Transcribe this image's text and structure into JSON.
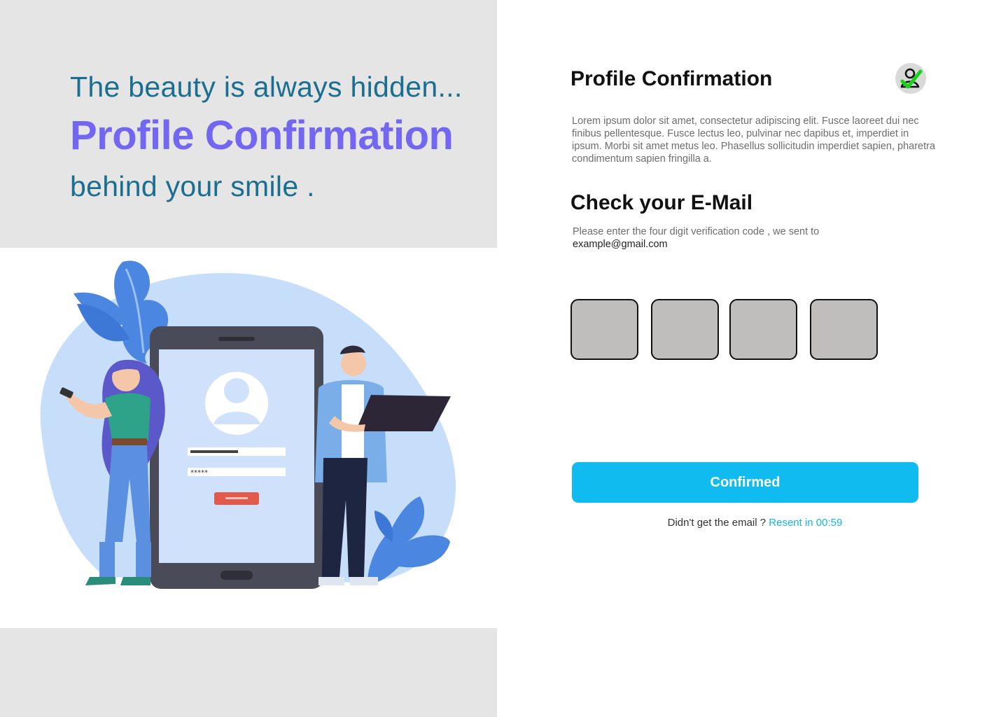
{
  "hero": {
    "tagline_top": "The beauty is always hidden...",
    "title": "Profile Confirmation",
    "tagline_bottom": "behind your smile ."
  },
  "form": {
    "title": "Profile Confirmation",
    "status_icon": "verified-user-check-icon",
    "description": "Lorem ipsum dolor sit amet, consectetur adipiscing elit. Fusce laoreet dui nec finibus pellentesque. Fusce lectus leo, pulvinar nec dapibus et, imperdiet in ipsum. Morbi sit amet metus leo. Phasellus sollicitudin imperdiet sapien, pharetra condimentum sapien fringilla a.",
    "section_heading": "Check your E-Mail",
    "instruction": "Please enter the four digit verification code , we sent to",
    "email": "example@gmail.com",
    "code_digits": [
      "",
      "",
      "",
      ""
    ],
    "confirm_label": "Confirmed",
    "resend_prompt": "Didn't get the email ?",
    "resend_link": "Resent in 00:59"
  },
  "colors": {
    "accent_purple": "#7366f0",
    "tagline_teal": "#1a6e8f",
    "button_blue": "#10bbef",
    "left_panel_gray": "#e5e5e5",
    "code_box_fill": "#bfbebc"
  }
}
